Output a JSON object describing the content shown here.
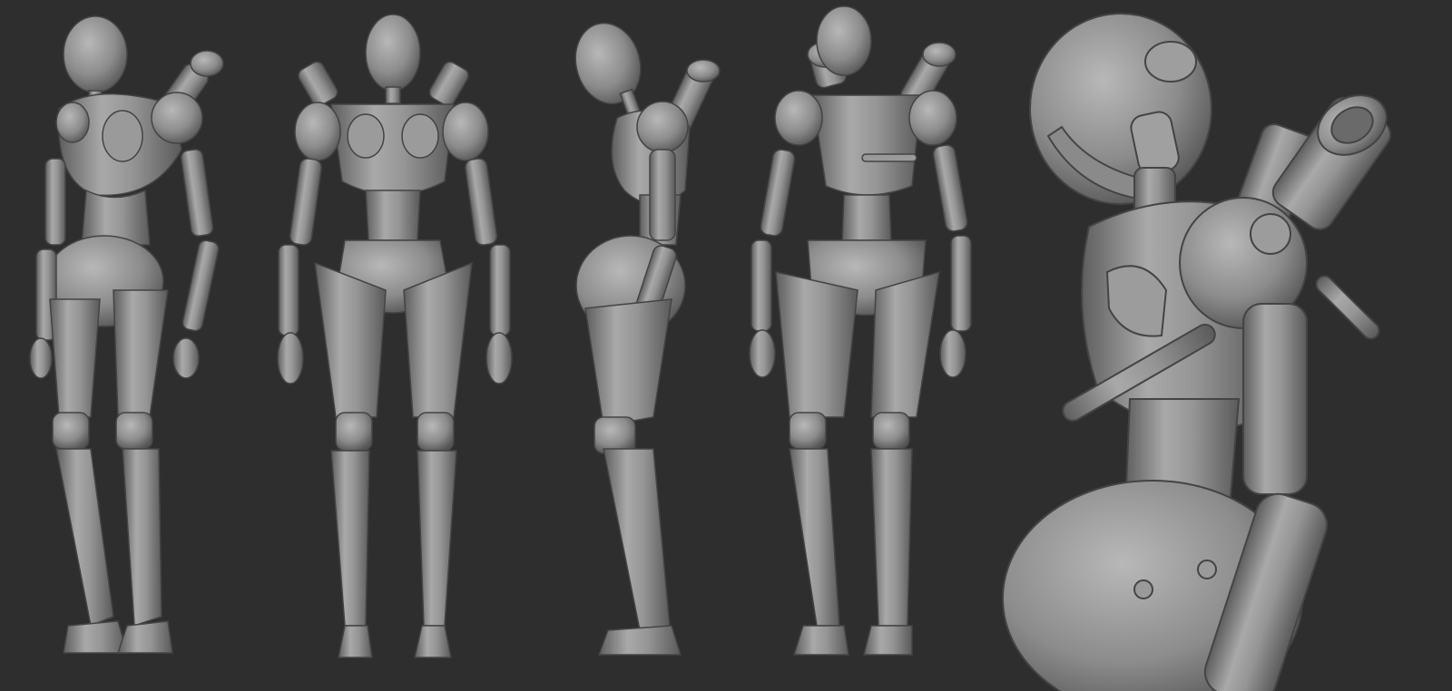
{
  "scene": {
    "background_color": "#2e2e2e",
    "material_base": "#8f8f8f",
    "material_light": "#b4b4b4",
    "material_dark": "#5c5c5c",
    "outline": "#4a4a4a"
  },
  "views": [
    {
      "id": "three-quarter-front",
      "icon": "robot-figure"
    },
    {
      "id": "front",
      "icon": "robot-figure"
    },
    {
      "id": "side",
      "icon": "robot-figure"
    },
    {
      "id": "back",
      "icon": "robot-figure"
    },
    {
      "id": "closeup-three-quarter",
      "icon": "robot-figure"
    }
  ]
}
